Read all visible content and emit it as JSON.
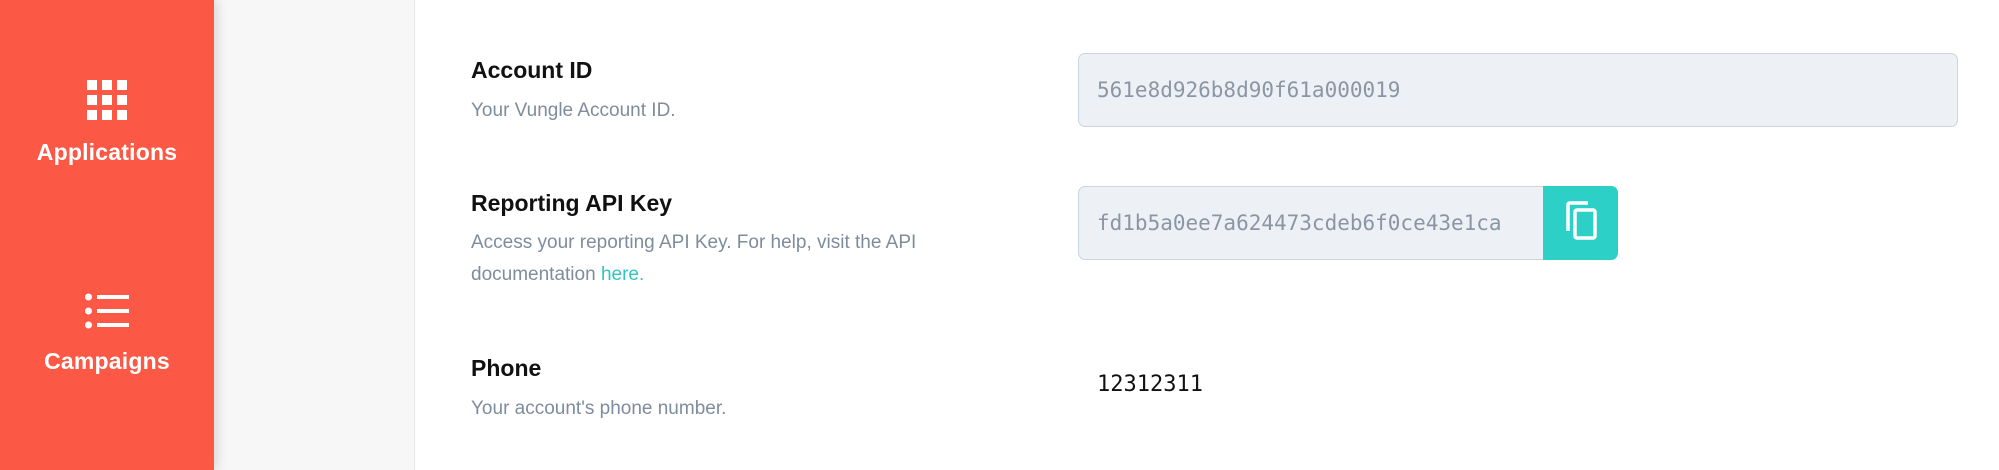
{
  "sidebar": {
    "items": [
      {
        "label": "Applications",
        "icon": "grid-icon"
      },
      {
        "label": "Campaigns",
        "icon": "list-icon"
      }
    ],
    "bg_color": "#fc5846"
  },
  "account": {
    "account_id": {
      "title": "Account ID",
      "description": "Your Vungle Account ID.",
      "value": "561e8d926b8d90f61a000019"
    },
    "api_key": {
      "title": "Reporting API Key",
      "description_prefix": "Access your reporting API Key. For help, visit the API documentation",
      "link_text": "here.",
      "value": "fd1b5a0ee7a624473cdeb6f0ce43e1ca",
      "copy_icon": "copy-icon"
    },
    "phone": {
      "title": "Phone",
      "description": "Your account's phone number.",
      "value": "12312311"
    }
  },
  "colors": {
    "accent": "#2cd0c7",
    "link": "#2fc6c2"
  }
}
